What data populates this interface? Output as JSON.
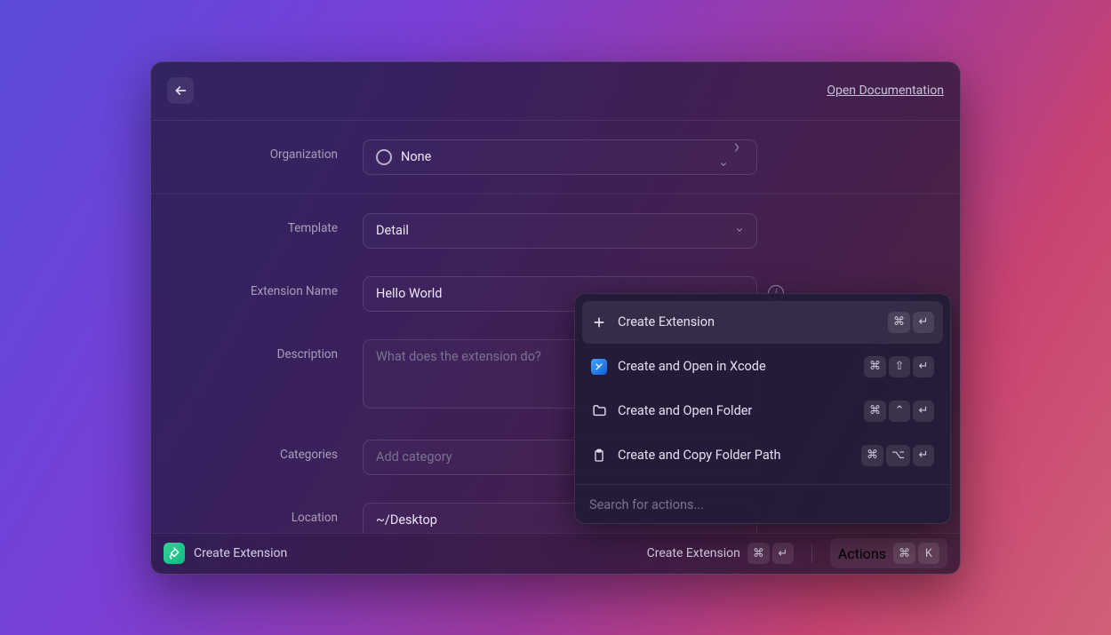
{
  "header": {
    "doc_link": "Open Documentation"
  },
  "form": {
    "organization": {
      "label": "Organization",
      "value": "None"
    },
    "template": {
      "label": "Template",
      "value": "Detail"
    },
    "extension_name": {
      "label": "Extension Name",
      "value": "Hello World"
    },
    "description": {
      "label": "Description",
      "placeholder": "What does the extension do?"
    },
    "categories": {
      "label": "Categories",
      "placeholder": "Add category"
    },
    "location": {
      "label": "Location",
      "value": "~/Desktop"
    }
  },
  "panel": {
    "items": [
      {
        "label": "Create Extension",
        "keys": [
          "⌘",
          "↵"
        ],
        "icon": "plus"
      },
      {
        "label": "Create and Open in Xcode",
        "keys": [
          "⌘",
          "⇧",
          "↵"
        ],
        "icon": "xcode"
      },
      {
        "label": "Create and Open Folder",
        "keys": [
          "⌘",
          "⌃",
          "↵"
        ],
        "icon": "folder"
      },
      {
        "label": "Create and Copy Folder Path",
        "keys": [
          "⌘",
          "⌥",
          "↵"
        ],
        "icon": "clipboard"
      }
    ],
    "search_placeholder": "Search for actions..."
  },
  "footer": {
    "app_title": "Create Extension",
    "primary_action": "Create Extension",
    "primary_keys": [
      "⌘",
      "↵"
    ],
    "actions_label": "Actions",
    "actions_keys": [
      "⌘",
      "K"
    ]
  }
}
